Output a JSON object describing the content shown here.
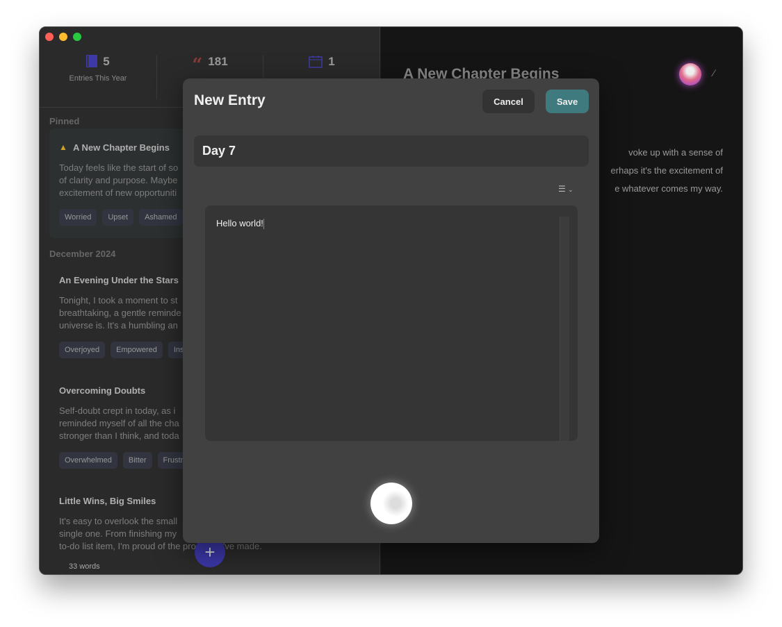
{
  "stats": [
    {
      "value": "5",
      "label": "Entries This Year",
      "icon": "book-icon",
      "color": "#3d3aa8"
    },
    {
      "value": "181",
      "icon": "quote-icon",
      "color": "#8a3a3a"
    },
    {
      "value": "1",
      "icon": "calendar-icon",
      "color": "#3d3aa8"
    }
  ],
  "sidebar": {
    "pinned_label": "Pinned",
    "pinned": {
      "title": "A New Chapter Begins",
      "body": "Today feels like the start of so\nof clarity and purpose. Maybe\nexcitement of new opportuniti",
      "tags": [
        "Worried",
        "Upset",
        "Ashamed"
      ]
    },
    "section_label": "December 2024",
    "entries": [
      {
        "title": "An Evening Under the Stars",
        "body": "Tonight, I took a moment to st\nbreathtaking, a gentle reminde\nuniverse is. It's a humbling an",
        "tags": [
          "Overjoyed",
          "Empowered",
          "Insp"
        ]
      },
      {
        "title": "Overcoming Doubts",
        "body": "Self-doubt crept in today, as i\nreminded myself of all the cha\nstronger than I think, and toda",
        "tags": [
          "Overwhelmed",
          "Bitter",
          "Frustra"
        ]
      },
      {
        "title": "Little Wins, Big Smiles",
        "body": "It's easy to overlook the small\nsingle one. From finishing my\nto-do list item, I'm proud of the progress I've made."
      }
    ],
    "word_count": "33 words",
    "add_label": "+"
  },
  "detail": {
    "title": "A New Chapter Begins",
    "body": "voke up with a sense of\nerhaps it's the excitement of\ne whatever comes my way."
  },
  "modal": {
    "title": "New Entry",
    "cancel": "Cancel",
    "save": "Save",
    "entry_title": "Day 7",
    "content": "Hello world!",
    "accent": "#3f7a7e"
  }
}
